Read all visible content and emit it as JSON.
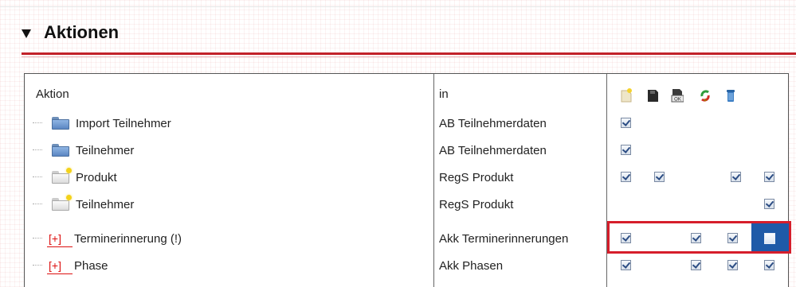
{
  "section": {
    "title": "Aktionen"
  },
  "table": {
    "headers": {
      "action": "Aktion",
      "in": "in"
    },
    "header_icons": [
      "new-document-icon",
      "save-icon",
      "save-ok-icon",
      "refresh-icon",
      "delete-icon"
    ],
    "rows": [
      {
        "label": "Import Teilnehmer",
        "in": "AB Teilnehmerdaten",
        "icon": "folder-icon",
        "checks": [
          true,
          null,
          null,
          null,
          null
        ]
      },
      {
        "label": "Teilnehmer",
        "in": "AB Teilnehmerdaten",
        "icon": "folder-icon",
        "checks": [
          true,
          null,
          null,
          null,
          null
        ]
      },
      {
        "label": "Produkt",
        "in": "RegS Produkt",
        "icon": "new-folder-icon",
        "checks": [
          true,
          true,
          null,
          true,
          true
        ]
      },
      {
        "label": "Teilnehmer",
        "in": "RegS Produkt",
        "icon": "new-folder-icon",
        "checks": [
          null,
          null,
          null,
          null,
          true
        ]
      },
      {
        "expand": "[+]",
        "label": "Terminerinnerung (!)",
        "in": "Akk Terminerinnerungen",
        "checks": [
          true,
          null,
          true,
          true,
          false
        ]
      },
      {
        "expand": "[+]",
        "label": "Phase",
        "in": "Akk Phasen",
        "checks": [
          true,
          null,
          true,
          true,
          true
        ]
      }
    ]
  }
}
